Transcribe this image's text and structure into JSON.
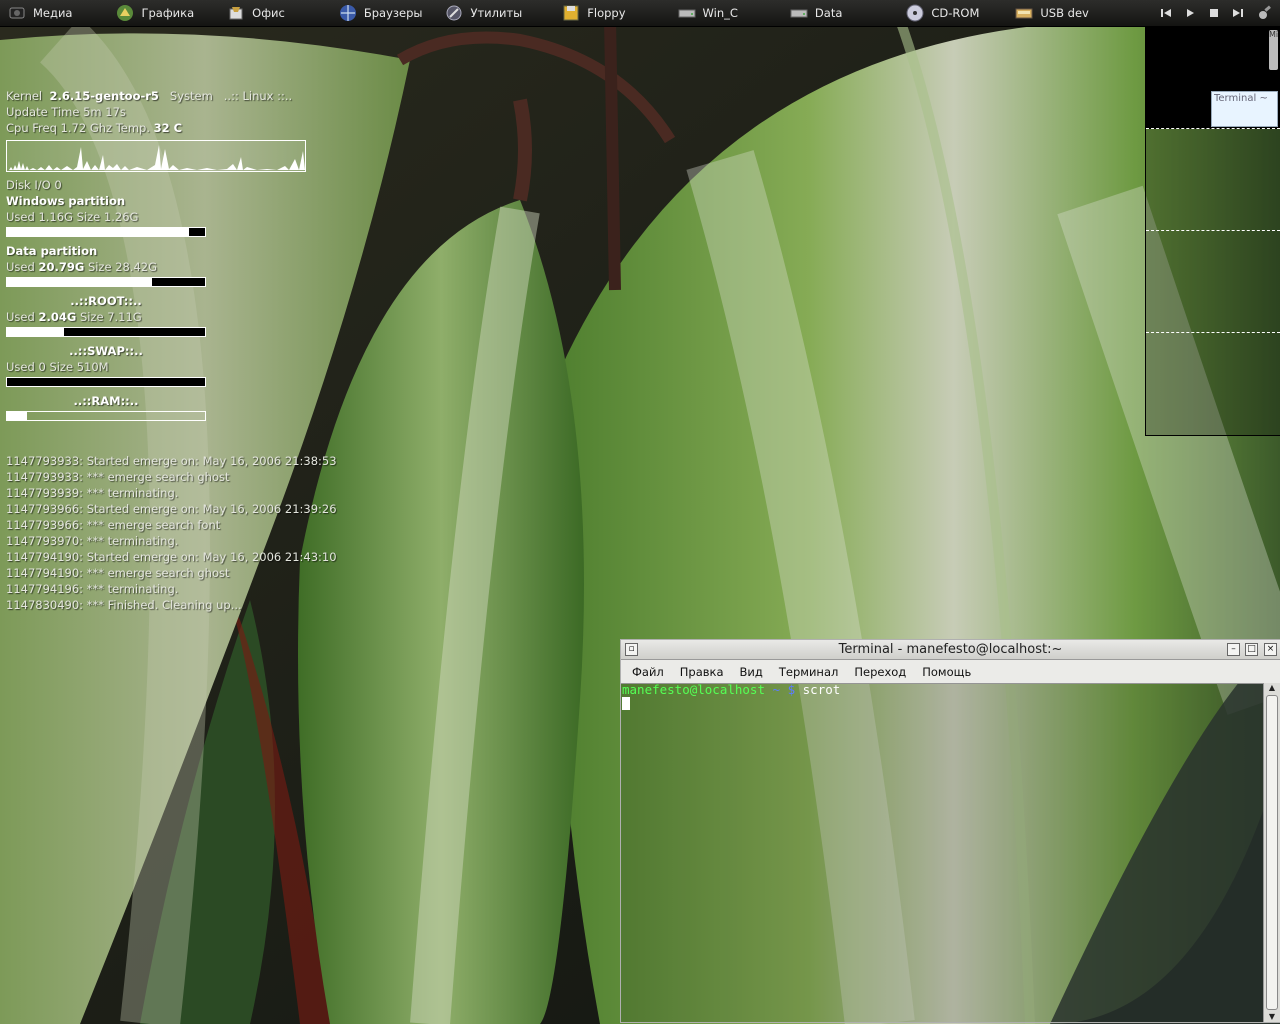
{
  "panel": {
    "launchers": [
      {
        "label": "Медиа",
        "icon": "media-icon"
      },
      {
        "label": "Графика",
        "icon": "graphics-icon"
      },
      {
        "label": "Офис",
        "icon": "office-icon"
      },
      {
        "label": "Браузеры",
        "icon": "browsers-icon"
      },
      {
        "label": "Утилиты",
        "icon": "utilities-icon"
      },
      {
        "label": "Floppy",
        "icon": "floppy-icon"
      },
      {
        "label": "Win_C",
        "icon": "drive-icon"
      },
      {
        "label": "Data",
        "icon": "drive-icon"
      },
      {
        "label": "CD-ROM",
        "icon": "cdrom-icon"
      },
      {
        "label": "USB dev",
        "icon": "usb-icon"
      }
    ],
    "media_controls": [
      "previous-icon",
      "play-icon",
      "stop-icon",
      "next-icon",
      "eject-icon"
    ]
  },
  "conky": {
    "kernel_label": "Kernel",
    "kernel": "2.6.15-gentoo-r5",
    "system_label": "System",
    "system": "..:: Linux ::..",
    "uptime": "Update Time 5m 17s",
    "cpu_label": "Cpu Freq 1.72 Ghz Temp.",
    "cpu_temp": "32 C",
    "disk_io": "Disk I/O 0",
    "partitions": [
      {
        "title": "Windows partition",
        "used_label": "Used",
        "used": "1.16G",
        "size_label": "Size",
        "size": "1.26G",
        "fill": 0.92
      },
      {
        "title": "Data partition",
        "used_label": "Used",
        "used": "20.79G",
        "size_label": "Size",
        "size": "28.42G",
        "fill": 0.73
      },
      {
        "title": "..::ROOT::..",
        "used_label": "Used",
        "used": "2.04G",
        "size_label": "Size",
        "size": "7.11G",
        "fill": 0.29
      },
      {
        "title": "..::SWAP::..",
        "used_label": "Used",
        "used": "0",
        "size_label": "Size",
        "size": "510M",
        "fill": 0.0
      }
    ],
    "ram_title": "..::RAM::..",
    "ram_fill": 0.1,
    "log": [
      "1147793933: Started emerge on: May 16, 2006 21:38:53",
      "1147793933:  *** emerge  search ghost",
      "1147793939:  *** terminating.",
      "1147793966: Started emerge on: May 16, 2006 21:39:26",
      "1147793966:  *** emerge  search font",
      "1147793970:  *** terminating.",
      "1147794190: Started emerge on: May 16, 2006 21:43:10",
      "1147794190:  *** emerge  search ghost",
      "1147794196:  *** terminating.",
      "1147830490:  *** Finished. Cleaning up..."
    ]
  },
  "pager": {
    "window_label": "Terminal ~",
    "scroll_label": "Mi"
  },
  "terminal": {
    "title": "Terminal - manefesto@localhost:~",
    "menu": [
      "Файл",
      "Правка",
      "Вид",
      "Терминал",
      "Переход",
      "Помощь"
    ],
    "prompt_user": "manefesto@localhost",
    "prompt_path": "~ $",
    "command": "scrot"
  },
  "colors": {
    "prompt_user": "#55ff55",
    "prompt_path": "#5c7cff",
    "panel_bg": "#1e1e1c",
    "leaf_green": "#5f8a3c"
  }
}
